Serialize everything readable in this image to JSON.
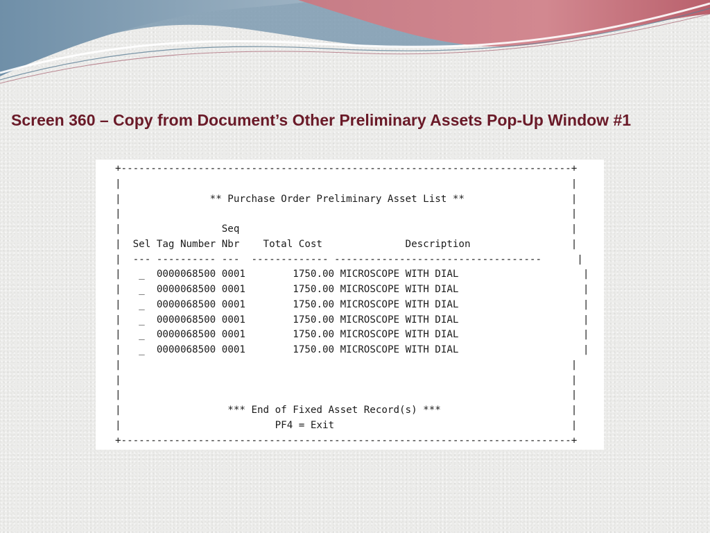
{
  "slide": {
    "title": "Screen 360 – Copy from Document’s Other Preliminary Assets Pop-Up Window #1"
  },
  "terminal": {
    "border_top": "+----------------------------------------------------------------------------+",
    "border_bottom": "+----------------------------------------------------------------------------+",
    "empty_line": "|                                                                            |",
    "heading": "|               ** Purchase Order Preliminary Asset List **                  |",
    "header_line1": "|                 Seq                                                        |",
    "header_line2": "|  Sel Tag Number Nbr    Total Cost              Description                 |",
    "separator": "|  --- ---------- ---  ------------- -----------------------------------      |",
    "rows": [
      {
        "sel": "_",
        "tag": "0000068500",
        "seq": "0001",
        "total_cost": "1750.00",
        "description": "MICROSCOPE WITH DIAL"
      },
      {
        "sel": "_",
        "tag": "0000068500",
        "seq": "0001",
        "total_cost": "1750.00",
        "description": "MICROSCOPE WITH DIAL"
      },
      {
        "sel": "_",
        "tag": "0000068500",
        "seq": "0001",
        "total_cost": "1750.00",
        "description": "MICROSCOPE WITH DIAL"
      },
      {
        "sel": "_",
        "tag": "0000068500",
        "seq": "0001",
        "total_cost": "1750.00",
        "description": "MICROSCOPE WITH DIAL"
      },
      {
        "sel": "_",
        "tag": "0000068500",
        "seq": "0001",
        "total_cost": "1750.00",
        "description": "MICROSCOPE WITH DIAL"
      },
      {
        "sel": "_",
        "tag": "0000068500",
        "seq": "0001",
        "total_cost": "1750.00",
        "description": "MICROSCOPE WITH DIAL"
      }
    ],
    "footer_message": "|                  *** End of Fixed Asset Record(s) ***                      |",
    "footer_keys": "|                          PF4 = Exit                                        |"
  }
}
